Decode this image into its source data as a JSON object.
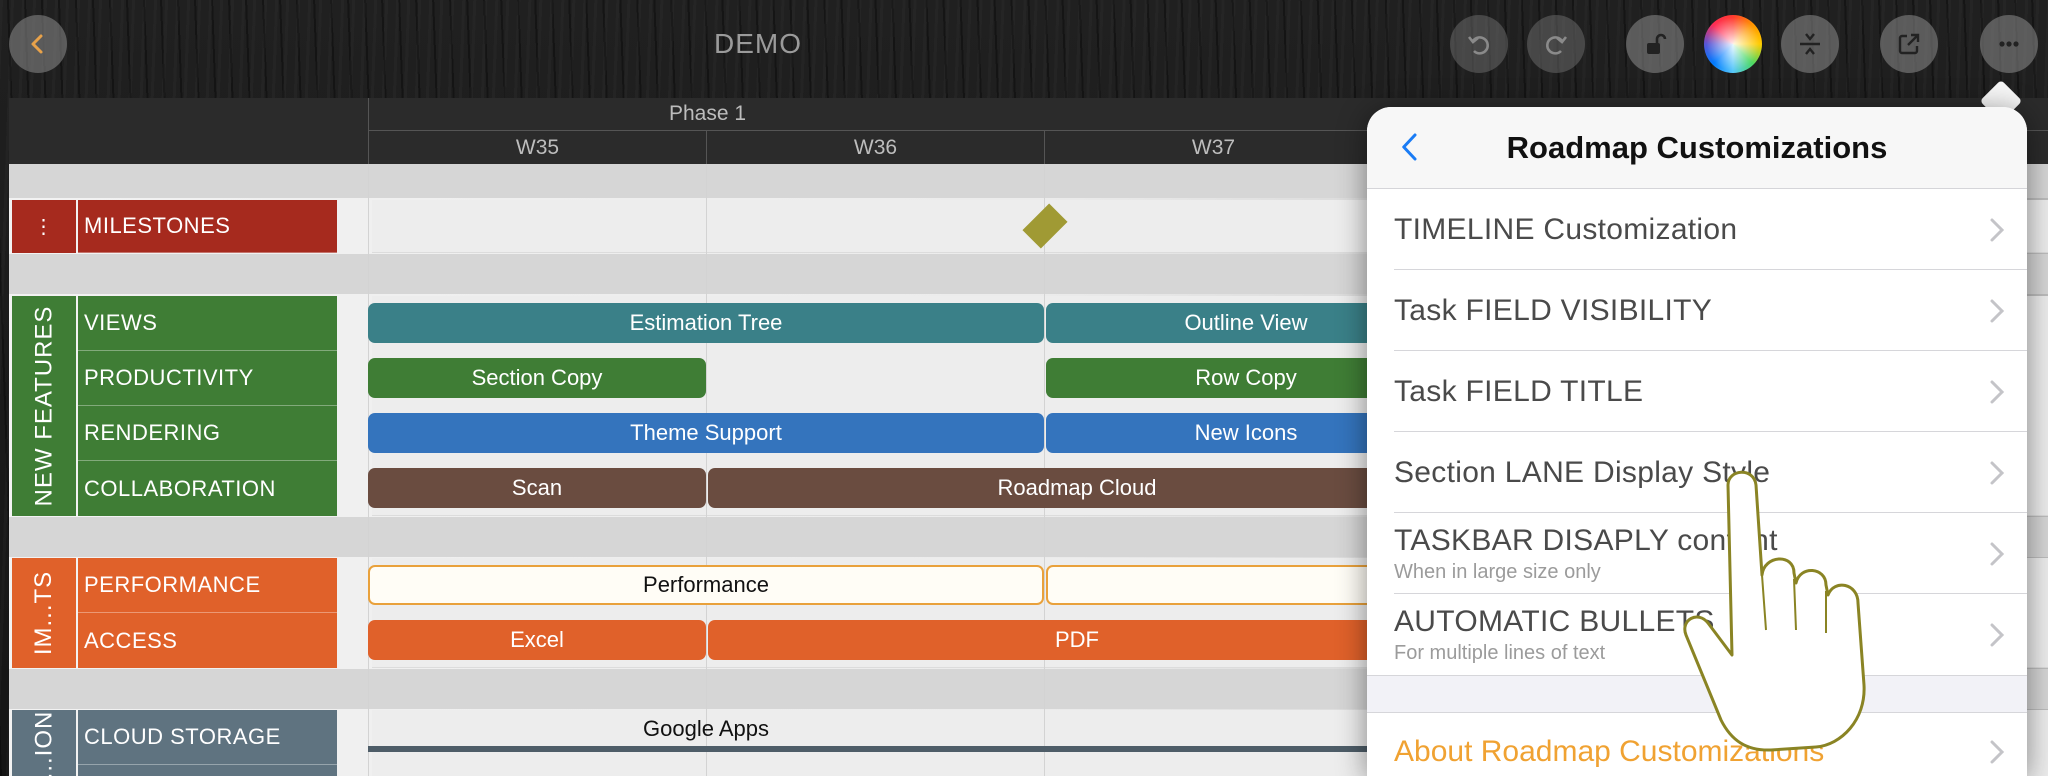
{
  "toolbar": {
    "title": "DEMO",
    "icons": [
      "chevron-left-icon",
      "undo-icon",
      "redo-icon",
      "unlock-icon",
      "color-wheel-icon",
      "row-height-icon",
      "share-icon",
      "more-icon"
    ]
  },
  "timeline": {
    "phase": "Phase 1",
    "weeks": [
      "W35",
      "W36",
      "W37"
    ]
  },
  "sections": {
    "milestones": {
      "label": "MILESTONES",
      "menu_glyph": "⋮",
      "color": "#a62a1e"
    },
    "new_features": {
      "label": "NEW FEATURES",
      "color": "#3f7d35",
      "lanes": [
        "VIEWS",
        "PRODUCTIVITY",
        "RENDERING",
        "COLLABORATION"
      ]
    },
    "improvements": {
      "label": "IM...TS",
      "color": "#e0612a",
      "lanes": [
        "PERFORMANCE",
        "ACCESS"
      ]
    },
    "integration": {
      "label": "...ION",
      "color": "#5f7380",
      "lanes": [
        "CLOUD STORAGE"
      ]
    }
  },
  "tasks": {
    "estimation_tree": "Estimation Tree",
    "outline_view": "Outline View",
    "section_copy": "Section Copy",
    "row_copy": "Row Copy",
    "theme_support": "Theme Support",
    "new_icons": "New Icons",
    "scan": "Scan",
    "roadmap_cloud": "Roadmap Cloud",
    "performance": "Performance",
    "excel": "Excel",
    "pdf": "PDF",
    "google_apps": "Google Apps"
  },
  "colors": {
    "views": "#3a8088",
    "productivity": "#3f7d35",
    "rendering": "#3474bd",
    "collaboration": "#6a4c40",
    "access": "#e0612a",
    "accent_orange": "#f0a232",
    "ios_blue": "#1a7cf5"
  },
  "popover": {
    "title": "Roadmap Customizations",
    "items": [
      {
        "title": "TIMELINE Customization",
        "subtitle": ""
      },
      {
        "title": "Task FIELD VISIBILITY",
        "subtitle": ""
      },
      {
        "title": "Task FIELD TITLE",
        "subtitle": ""
      },
      {
        "title": "Section LANE Display Style",
        "subtitle": ""
      },
      {
        "title": "TASKBAR DISAPLY content",
        "subtitle": "When in large size only"
      },
      {
        "title": "AUTOMATIC BULLETS",
        "subtitle": "For multiple lines of text"
      }
    ],
    "about": "About Roadmap Customizations"
  }
}
